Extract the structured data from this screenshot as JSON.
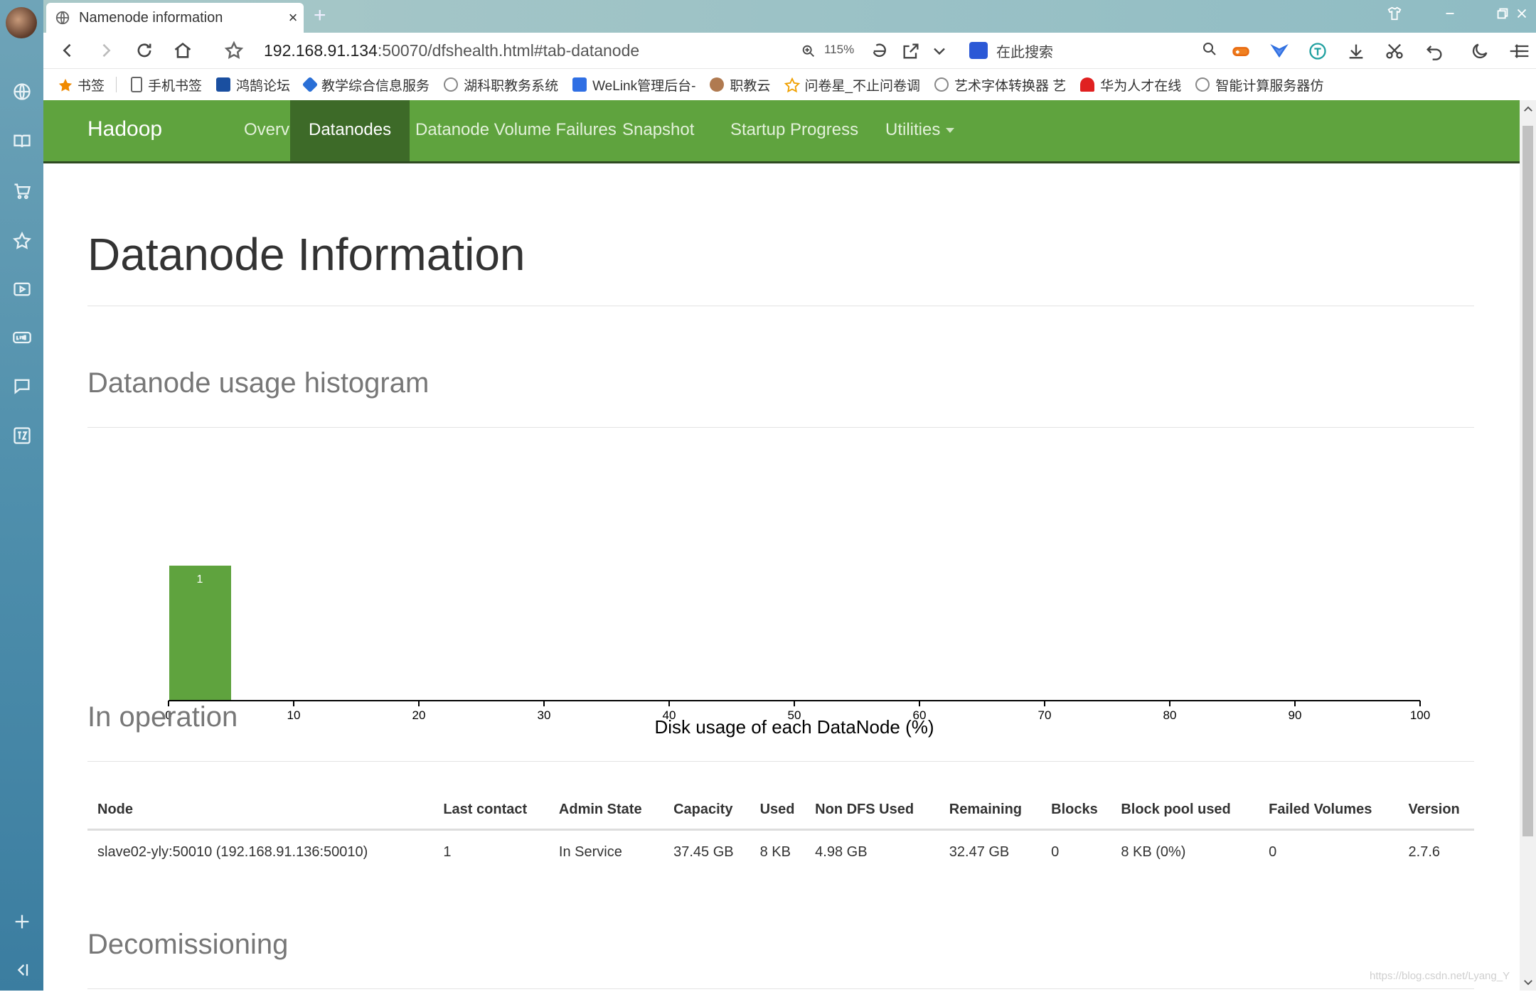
{
  "browser": {
    "tab_title": "Namenode information",
    "tab_close": "×",
    "new_tab": "+",
    "url_host": "192.168.91.134",
    "url_path": ":50070/dfshealth.html#tab-datanode",
    "zoom_level": "115%",
    "search_placeholder": "在此搜索",
    "window_controls": [
      "shirt-icon",
      "minimize-icon",
      "restore-icon",
      "close-icon"
    ]
  },
  "bookmarks": [
    {
      "label": "书签",
      "icon": "star-icon",
      "color": "#f08a00"
    },
    {
      "label": "手机书签",
      "icon": "phone-icon",
      "color": "#666666"
    },
    {
      "label": "鸿鹄论坛",
      "icon": "hh-logo-icon",
      "color": "#1a4fa0"
    },
    {
      "label": "教学综合信息服务",
      "icon": "edu-logo-icon",
      "color": "#2a6fd6"
    },
    {
      "label": "湖科职教务系统",
      "icon": "globe-icon",
      "color": "#888888"
    },
    {
      "label": "WeLink管理后台-",
      "icon": "welink-icon",
      "color": "#2f6fe4"
    },
    {
      "label": "职教云",
      "icon": "cloud-logo-icon",
      "color": "#b07a50"
    },
    {
      "label": "问卷星_不止问卷调",
      "icon": "wjx-star-icon",
      "color": "#f0a000"
    },
    {
      "label": "艺术字体转换器 艺",
      "icon": "globe-icon",
      "color": "#888888"
    },
    {
      "label": "华为人才在线",
      "icon": "huawei-icon",
      "color": "#e02020"
    },
    {
      "label": "智能计算服务器仿",
      "icon": "globe-icon",
      "color": "#888888"
    }
  ],
  "hadoop_nav": {
    "brand": "Hadoop",
    "links": [
      "Overview",
      "Datanodes",
      "Datanode Volume Failures",
      "Snapshot",
      "Startup Progress",
      "Utilities"
    ],
    "active": "Datanodes"
  },
  "page": {
    "title": "Datanode Information",
    "histogram_heading": "Datanode usage histogram",
    "in_operation_heading": "In operation",
    "decommissioning_heading": "Decomissioning"
  },
  "chart_data": {
    "type": "bar",
    "xlabel": "Disk usage of each DataNode (%)",
    "xlim": [
      0,
      100
    ],
    "xticks": [
      0,
      10,
      20,
      30,
      40,
      50,
      60,
      70,
      80,
      90,
      100
    ],
    "bins": [
      {
        "x0": 0,
        "x1": 5,
        "count": 1
      }
    ],
    "data_labels": [
      "1"
    ],
    "bar_color": "#5fa33e"
  },
  "table": {
    "headers": [
      "Node",
      "Last contact",
      "Admin State",
      "Capacity",
      "Used",
      "Non DFS Used",
      "Remaining",
      "Blocks",
      "Block pool used",
      "Failed Volumes",
      "Version"
    ],
    "rows": [
      [
        "slave02-yly:50010 (192.168.91.136:50010)",
        "1",
        "In Service",
        "37.45 GB",
        "8 KB",
        "4.98 GB",
        "32.47 GB",
        "0",
        "8 KB (0%)",
        "0",
        "2.7.6"
      ]
    ]
  },
  "watermark": "https://blog.csdn.net/Lyang_Y"
}
